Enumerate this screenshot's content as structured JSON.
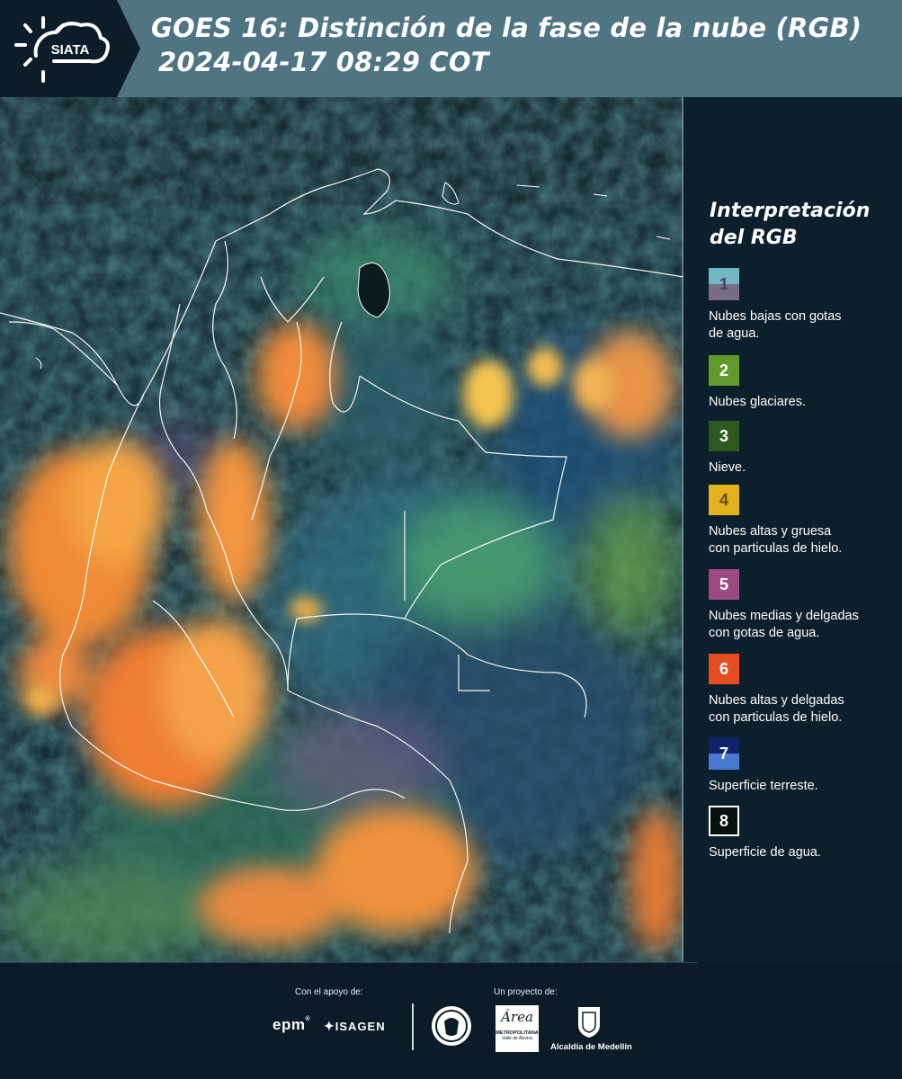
{
  "header": {
    "logo_text": "SIATA",
    "title_line1": "GOES 16: Distinción de la fase de la nube (RGB)",
    "title_line2": "2024-04-17 08:29 COT"
  },
  "legend": {
    "title_line1": "Interpretación",
    "title_line2": "del RGB",
    "items": [
      {
        "number": "1",
        "label_line1": "Nubes bajas con gotas",
        "label_line2": "de agua.",
        "color_top": "#6fb8c4",
        "color_bottom": "#7a6c84",
        "number_color": "#4a4455"
      },
      {
        "number": "2",
        "label_line1": "Nubes glaciares.",
        "label_line2": "",
        "color_top": "#5f9a2c",
        "color_bottom": "#5f9a2c",
        "number_color": "#ffffff"
      },
      {
        "number": "3",
        "label_line1": "Nieve.",
        "label_line2": "",
        "color_top": "#2e5a1f",
        "color_bottom": "#2e5a1f",
        "number_color": "#ffffff"
      },
      {
        "number": "4",
        "label_line1": "Nubes altas y gruesa",
        "label_line2": "con particulas de hielo.",
        "color_top": "#e3b21c",
        "color_bottom": "#e3b21c",
        "number_color": "#5b4a16"
      },
      {
        "number": "5",
        "label_line1": "Nubes medias y delgadas",
        "label_line2": "con gotas de agua.",
        "color_top": "#9c4a82",
        "color_bottom": "#9c4a82",
        "number_color": "#ffffff"
      },
      {
        "number": "6",
        "label_line1": "Nubes altas y delgadas",
        "label_line2": "con particulas de hielo.",
        "color_top": "#e64d23",
        "color_bottom": "#e64d23",
        "number_color": "#ffffff"
      },
      {
        "number": "7",
        "label_line1": "Superficie terreste.",
        "label_line2": "",
        "color_top": "#10226a",
        "color_bottom": "#4a79d2",
        "number_color": "#ffffff"
      },
      {
        "number": "8",
        "label_line1": "Superficie de agua.",
        "label_line2": "",
        "color_top": "#071210",
        "color_bottom": "#071210",
        "number_color": "#ffffff",
        "border": "#ffffff"
      }
    ]
  },
  "footer": {
    "support_label": "Con el apoyo de:",
    "project_label": "Un proyecto de:",
    "sponsor_epm": "epm",
    "sponsor_isagen": "ISAGEN",
    "area_name": "Área",
    "area_sub1": "METROPOLITANA",
    "area_sub2": "Valle de Aburrá",
    "alcaldia": "Alcaldía de Medellín"
  },
  "colors": {
    "header_bg": "#4f7482",
    "logo_bg": "#0d1c29",
    "page_bg": "#0c1f2c",
    "cloud_orange": "#f3913a",
    "cloud_yellow": "#f2c04a",
    "green_cloud": "#5fae6a",
    "teal_cloud": "#3f8f9a",
    "dark_ocean": "#0e232b",
    "border_white": "#ffffff"
  }
}
